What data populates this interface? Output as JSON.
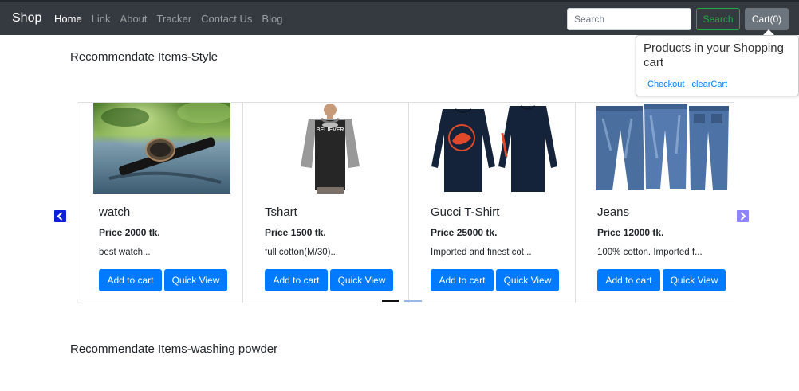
{
  "navbar": {
    "brand": "Shop",
    "links": [
      {
        "label": "Home",
        "active": true
      },
      {
        "label": "Link",
        "active": false
      },
      {
        "label": "About",
        "active": false
      },
      {
        "label": "Tracker",
        "active": false
      },
      {
        "label": "Contact Us",
        "active": false
      },
      {
        "label": "Blog",
        "active": false
      }
    ],
    "search_placeholder": "Search",
    "search_button": "Search",
    "cart_button": "Cart(0)"
  },
  "cart_popover": {
    "title": "Products in your Shopping cart",
    "checkout_link": "Checkout",
    "clear_link": "clearCart"
  },
  "sections": {
    "style_title": "Recommendate Items-Style",
    "washing_title": "Recommendate Items-washing powder"
  },
  "products": [
    {
      "name": "watch",
      "price": "Price 2000 tk.",
      "desc": "best watch...",
      "add_label": "Add to cart",
      "quick_label": "Quick View",
      "image_icon": "watch-photo"
    },
    {
      "name": "Tshart",
      "price": "Price 1500 tk.",
      "desc": "full cotton(M/30)...",
      "add_label": "Add to cart",
      "quick_label": "Quick View",
      "image_icon": "tshirt-photo"
    },
    {
      "name": "Gucci T-Shirt",
      "price": "Price 25000 tk.",
      "desc": "Imported and finest cot...",
      "add_label": "Add to cart",
      "quick_label": "Quick View",
      "image_icon": "longsleeve-photo"
    },
    {
      "name": "Jeans",
      "price": "Price 12000 tk.",
      "desc": "100% cotton. Imported f...",
      "add_label": "Add to cart",
      "quick_label": "Quick View",
      "image_icon": "jeans-photo"
    }
  ],
  "colors": {
    "navbar_bg": "#343a40",
    "primary": "#007bff",
    "search_green": "#28a745",
    "cart_gray": "#6c757d"
  },
  "carousel": {
    "active_slide": 1,
    "slide_count": 2
  }
}
